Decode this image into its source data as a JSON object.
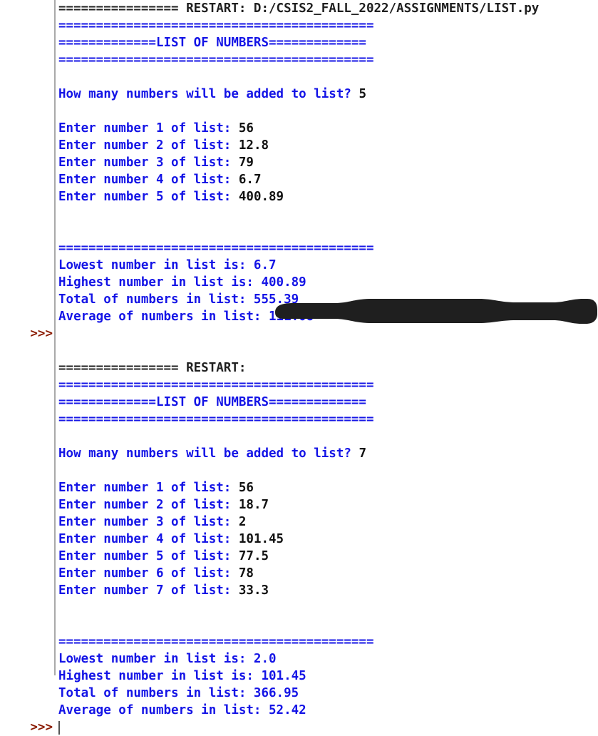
{
  "window": {
    "app": "Python IDLE Shell",
    "background_color": "#ffffff",
    "prompt_color": "#8b1a00",
    "output_color": "#1414e6",
    "input_color": "#111111",
    "restart_color": "#202020",
    "gutter_rule_color": "#a9a9a9"
  },
  "redaction": {
    "present": true,
    "label": "black-marker-redaction-over-file-path",
    "color": "#1f1f1f"
  },
  "console": {
    "lines": [
      {
        "id": "restart-line-top",
        "prompt": "",
        "segments": [
          {
            "text": "================ RESTART: D:/CSIS2_FALL_2022/ASSIGNMENTS/LIST.py",
            "style": "dark"
          }
        ],
        "clipped_top": true
      },
      {
        "id": "sep-1a",
        "prompt": "",
        "segments": [
          {
            "text": "==========================================",
            "style": "blue"
          }
        ]
      },
      {
        "id": "title-1",
        "prompt": "",
        "segments": [
          {
            "text": "=============LIST OF NUMBERS=============",
            "style": "blue"
          }
        ]
      },
      {
        "id": "sep-1b",
        "prompt": "",
        "segments": [
          {
            "text": "==========================================",
            "style": "blue"
          }
        ]
      },
      {
        "id": "blank-1",
        "prompt": "",
        "segments": [
          {
            "text": "",
            "style": "blue"
          }
        ]
      },
      {
        "id": "howmany-1",
        "prompt": "",
        "segments": [
          {
            "text": "How many numbers will be added to list? ",
            "style": "blue"
          },
          {
            "text": "5",
            "style": "black"
          }
        ]
      },
      {
        "id": "blank-2",
        "prompt": "",
        "segments": [
          {
            "text": "",
            "style": "blue"
          }
        ]
      },
      {
        "id": "entry-1-1",
        "prompt": "",
        "segments": [
          {
            "text": "Enter number 1 of list: ",
            "style": "blue"
          },
          {
            "text": "56",
            "style": "black"
          }
        ]
      },
      {
        "id": "entry-1-2",
        "prompt": "",
        "segments": [
          {
            "text": "Enter number 2 of list: ",
            "style": "blue"
          },
          {
            "text": "12.8",
            "style": "black"
          }
        ]
      },
      {
        "id": "entry-1-3",
        "prompt": "",
        "segments": [
          {
            "text": "Enter number 3 of list: ",
            "style": "blue"
          },
          {
            "text": "79",
            "style": "black"
          }
        ]
      },
      {
        "id": "entry-1-4",
        "prompt": "",
        "segments": [
          {
            "text": "Enter number 4 of list: ",
            "style": "blue"
          },
          {
            "text": "6.7",
            "style": "black"
          }
        ]
      },
      {
        "id": "entry-1-5",
        "prompt": "",
        "segments": [
          {
            "text": "Enter number 5 of list: ",
            "style": "blue"
          },
          {
            "text": "400.89",
            "style": "black"
          }
        ]
      },
      {
        "id": "blank-3",
        "prompt": "",
        "segments": [
          {
            "text": "",
            "style": "blue"
          }
        ]
      },
      {
        "id": "blank-4",
        "prompt": "",
        "segments": [
          {
            "text": "",
            "style": "blue"
          }
        ]
      },
      {
        "id": "sep-1c",
        "prompt": "",
        "segments": [
          {
            "text": "==========================================",
            "style": "blue"
          }
        ]
      },
      {
        "id": "lowest-1",
        "prompt": "",
        "segments": [
          {
            "text": "Lowest number in list is: 6.7",
            "style": "blue"
          }
        ]
      },
      {
        "id": "highest-1",
        "prompt": "",
        "segments": [
          {
            "text": "Highest number in list is: 400.89",
            "style": "blue"
          }
        ]
      },
      {
        "id": "total-1",
        "prompt": "",
        "segments": [
          {
            "text": "Total of numbers in list: 555.39",
            "style": "blue"
          }
        ]
      },
      {
        "id": "average-1",
        "prompt": "",
        "segments": [
          {
            "text": "Average of numbers in list: 111.08",
            "style": "blue"
          }
        ]
      },
      {
        "id": "prompt-1",
        "prompt": ">>>",
        "segments": [
          {
            "text": "",
            "style": "blue"
          }
        ]
      },
      {
        "id": "blank-5",
        "prompt": "",
        "segments": [
          {
            "text": "",
            "style": "blue"
          }
        ]
      },
      {
        "id": "restart-line-mid",
        "prompt": "",
        "segments": [
          {
            "text": "================ RESTART: ",
            "style": "dark"
          }
        ]
      },
      {
        "id": "sep-2a",
        "prompt": "",
        "segments": [
          {
            "text": "==========================================",
            "style": "blue"
          }
        ]
      },
      {
        "id": "title-2",
        "prompt": "",
        "segments": [
          {
            "text": "=============LIST OF NUMBERS=============",
            "style": "blue"
          }
        ]
      },
      {
        "id": "sep-2b",
        "prompt": "",
        "segments": [
          {
            "text": "==========================================",
            "style": "blue"
          }
        ]
      },
      {
        "id": "blank-6",
        "prompt": "",
        "segments": [
          {
            "text": "",
            "style": "blue"
          }
        ]
      },
      {
        "id": "howmany-2",
        "prompt": "",
        "segments": [
          {
            "text": "How many numbers will be added to list? ",
            "style": "blue"
          },
          {
            "text": "7",
            "style": "black"
          }
        ]
      },
      {
        "id": "blank-7",
        "prompt": "",
        "segments": [
          {
            "text": "",
            "style": "blue"
          }
        ]
      },
      {
        "id": "entry-2-1",
        "prompt": "",
        "segments": [
          {
            "text": "Enter number 1 of list: ",
            "style": "blue"
          },
          {
            "text": "56",
            "style": "black"
          }
        ]
      },
      {
        "id": "entry-2-2",
        "prompt": "",
        "segments": [
          {
            "text": "Enter number 2 of list: ",
            "style": "blue"
          },
          {
            "text": "18.7",
            "style": "black"
          }
        ]
      },
      {
        "id": "entry-2-3",
        "prompt": "",
        "segments": [
          {
            "text": "Enter number 3 of list: ",
            "style": "blue"
          },
          {
            "text": "2",
            "style": "black"
          }
        ]
      },
      {
        "id": "entry-2-4",
        "prompt": "",
        "segments": [
          {
            "text": "Enter number 4 of list: ",
            "style": "blue"
          },
          {
            "text": "101.45",
            "style": "black"
          }
        ]
      },
      {
        "id": "entry-2-5",
        "prompt": "",
        "segments": [
          {
            "text": "Enter number 5 of list: ",
            "style": "blue"
          },
          {
            "text": "77.5",
            "style": "black"
          }
        ]
      },
      {
        "id": "entry-2-6",
        "prompt": "",
        "segments": [
          {
            "text": "Enter number 6 of list: ",
            "style": "blue"
          },
          {
            "text": "78",
            "style": "black"
          }
        ]
      },
      {
        "id": "entry-2-7",
        "prompt": "",
        "segments": [
          {
            "text": "Enter number 7 of list: ",
            "style": "blue"
          },
          {
            "text": "33.3",
            "style": "black"
          }
        ]
      },
      {
        "id": "blank-8",
        "prompt": "",
        "segments": [
          {
            "text": "",
            "style": "blue"
          }
        ]
      },
      {
        "id": "blank-9",
        "prompt": "",
        "segments": [
          {
            "text": "",
            "style": "blue"
          }
        ]
      },
      {
        "id": "sep-2c",
        "prompt": "",
        "segments": [
          {
            "text": "==========================================",
            "style": "blue"
          }
        ]
      },
      {
        "id": "lowest-2",
        "prompt": "",
        "segments": [
          {
            "text": "Lowest number in list is: 2.0",
            "style": "blue"
          }
        ]
      },
      {
        "id": "highest-2",
        "prompt": "",
        "segments": [
          {
            "text": "Highest number in list is: 101.45",
            "style": "blue"
          }
        ]
      },
      {
        "id": "total-2",
        "prompt": "",
        "segments": [
          {
            "text": "Total of numbers in list: 366.95",
            "style": "blue"
          }
        ]
      },
      {
        "id": "average-2",
        "prompt": "",
        "segments": [
          {
            "text": "Average of numbers in list: 52.42",
            "style": "blue"
          }
        ]
      },
      {
        "id": "prompt-2",
        "prompt": ">>>",
        "segments": [
          {
            "text": "",
            "style": "blue"
          }
        ],
        "caret": true
      }
    ]
  }
}
